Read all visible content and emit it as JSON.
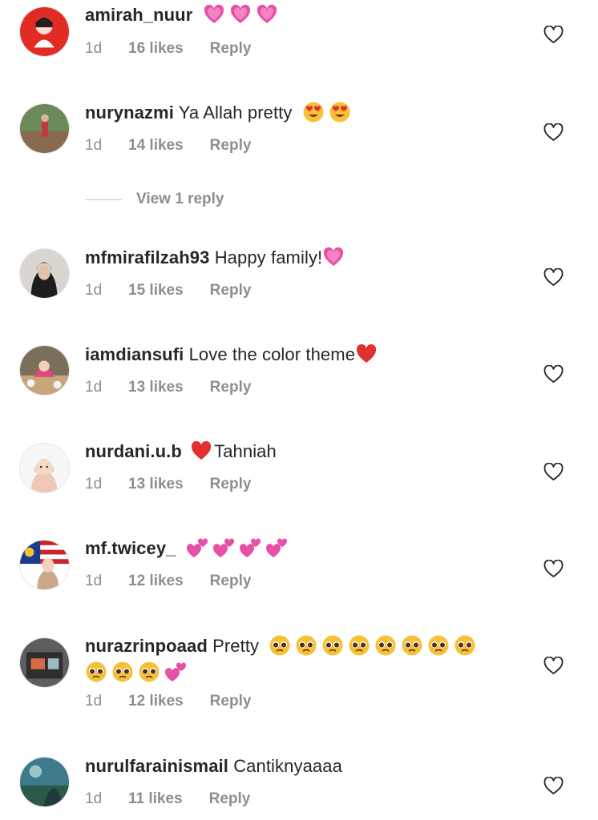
{
  "comments": [
    {
      "username": "amirah_nuur",
      "text": "",
      "emojis": [
        "pink-heart",
        "pink-heart",
        "pink-heart"
      ],
      "time": "1d",
      "likes": "16 likes",
      "reply": "Reply"
    },
    {
      "username": "nurynazmi",
      "text": "Ya Allah pretty",
      "emojis": [
        "heart-eyes",
        "heart-eyes"
      ],
      "time": "1d",
      "likes": "14 likes",
      "reply": "Reply"
    },
    {
      "username": "mfmirafilzah93",
      "text": "Happy family!",
      "emojis": [
        "pink-heart"
      ],
      "time": "1d",
      "likes": "15 likes",
      "reply": "Reply"
    },
    {
      "username": "iamdiansufi",
      "text": "Love the color theme",
      "emojis": [
        "red-heart"
      ],
      "time": "1d",
      "likes": "13 likes",
      "reply": "Reply"
    },
    {
      "username": "nurdani.u.b",
      "text": "Tahniah",
      "emojis_before": [
        "red-heart"
      ],
      "time": "1d",
      "likes": "13 likes",
      "reply": "Reply"
    },
    {
      "username": "mf.twicey_",
      "text": "",
      "emojis": [
        "two-hearts",
        "two-hearts",
        "two-hearts",
        "two-hearts"
      ],
      "time": "1d",
      "likes": "12 likes",
      "reply": "Reply"
    },
    {
      "username": "nurazrinpoaad",
      "text": "Pretty",
      "emojis": [
        "pleading-face",
        "pleading-face",
        "pleading-face",
        "pleading-face",
        "pleading-face",
        "pleading-face",
        "pleading-face",
        "pleading-face",
        "pleading-face",
        "pleading-face",
        "pleading-face",
        "two-hearts"
      ],
      "time": "1d",
      "likes": "12 likes",
      "reply": "Reply"
    },
    {
      "username": "nurulfarainismail",
      "text": "Cantiknyaaaa",
      "emojis": [],
      "time": "1d",
      "likes": "11 likes",
      "reply": "Reply"
    }
  ],
  "view_replies": {
    "label": "View 1 reply"
  },
  "colors": {
    "text": "#262626",
    "secondary": "#8e8e8e",
    "pink_heart": "#e84fa5",
    "red_heart": "#e0302f",
    "emoji_yellow": "#f6c137"
  },
  "icons": {
    "like": "heart-outline-icon"
  }
}
